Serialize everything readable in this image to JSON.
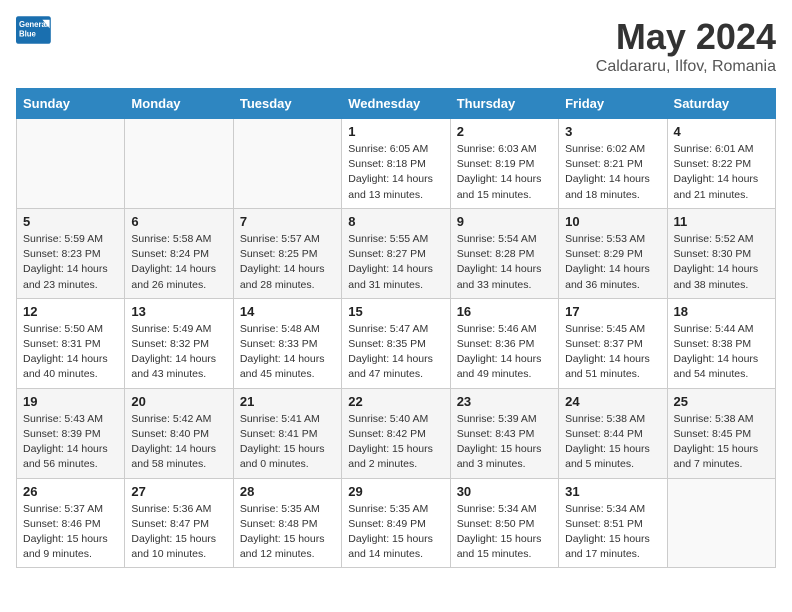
{
  "header": {
    "logo_general": "General",
    "logo_blue": "Blue",
    "month_year": "May 2024",
    "location": "Caldararu, Ilfov, Romania"
  },
  "days_of_week": [
    "Sunday",
    "Monday",
    "Tuesday",
    "Wednesday",
    "Thursday",
    "Friday",
    "Saturday"
  ],
  "weeks": [
    [
      {
        "day": "",
        "sunrise": "",
        "sunset": "",
        "daylight": ""
      },
      {
        "day": "",
        "sunrise": "",
        "sunset": "",
        "daylight": ""
      },
      {
        "day": "",
        "sunrise": "",
        "sunset": "",
        "daylight": ""
      },
      {
        "day": "1",
        "sunrise": "Sunrise: 6:05 AM",
        "sunset": "Sunset: 8:18 PM",
        "daylight": "Daylight: 14 hours and 13 minutes."
      },
      {
        "day": "2",
        "sunrise": "Sunrise: 6:03 AM",
        "sunset": "Sunset: 8:19 PM",
        "daylight": "Daylight: 14 hours and 15 minutes."
      },
      {
        "day": "3",
        "sunrise": "Sunrise: 6:02 AM",
        "sunset": "Sunset: 8:21 PM",
        "daylight": "Daylight: 14 hours and 18 minutes."
      },
      {
        "day": "4",
        "sunrise": "Sunrise: 6:01 AM",
        "sunset": "Sunset: 8:22 PM",
        "daylight": "Daylight: 14 hours and 21 minutes."
      }
    ],
    [
      {
        "day": "5",
        "sunrise": "Sunrise: 5:59 AM",
        "sunset": "Sunset: 8:23 PM",
        "daylight": "Daylight: 14 hours and 23 minutes."
      },
      {
        "day": "6",
        "sunrise": "Sunrise: 5:58 AM",
        "sunset": "Sunset: 8:24 PM",
        "daylight": "Daylight: 14 hours and 26 minutes."
      },
      {
        "day": "7",
        "sunrise": "Sunrise: 5:57 AM",
        "sunset": "Sunset: 8:25 PM",
        "daylight": "Daylight: 14 hours and 28 minutes."
      },
      {
        "day": "8",
        "sunrise": "Sunrise: 5:55 AM",
        "sunset": "Sunset: 8:27 PM",
        "daylight": "Daylight: 14 hours and 31 minutes."
      },
      {
        "day": "9",
        "sunrise": "Sunrise: 5:54 AM",
        "sunset": "Sunset: 8:28 PM",
        "daylight": "Daylight: 14 hours and 33 minutes."
      },
      {
        "day": "10",
        "sunrise": "Sunrise: 5:53 AM",
        "sunset": "Sunset: 8:29 PM",
        "daylight": "Daylight: 14 hours and 36 minutes."
      },
      {
        "day": "11",
        "sunrise": "Sunrise: 5:52 AM",
        "sunset": "Sunset: 8:30 PM",
        "daylight": "Daylight: 14 hours and 38 minutes."
      }
    ],
    [
      {
        "day": "12",
        "sunrise": "Sunrise: 5:50 AM",
        "sunset": "Sunset: 8:31 PM",
        "daylight": "Daylight: 14 hours and 40 minutes."
      },
      {
        "day": "13",
        "sunrise": "Sunrise: 5:49 AM",
        "sunset": "Sunset: 8:32 PM",
        "daylight": "Daylight: 14 hours and 43 minutes."
      },
      {
        "day": "14",
        "sunrise": "Sunrise: 5:48 AM",
        "sunset": "Sunset: 8:33 PM",
        "daylight": "Daylight: 14 hours and 45 minutes."
      },
      {
        "day": "15",
        "sunrise": "Sunrise: 5:47 AM",
        "sunset": "Sunset: 8:35 PM",
        "daylight": "Daylight: 14 hours and 47 minutes."
      },
      {
        "day": "16",
        "sunrise": "Sunrise: 5:46 AM",
        "sunset": "Sunset: 8:36 PM",
        "daylight": "Daylight: 14 hours and 49 minutes."
      },
      {
        "day": "17",
        "sunrise": "Sunrise: 5:45 AM",
        "sunset": "Sunset: 8:37 PM",
        "daylight": "Daylight: 14 hours and 51 minutes."
      },
      {
        "day": "18",
        "sunrise": "Sunrise: 5:44 AM",
        "sunset": "Sunset: 8:38 PM",
        "daylight": "Daylight: 14 hours and 54 minutes."
      }
    ],
    [
      {
        "day": "19",
        "sunrise": "Sunrise: 5:43 AM",
        "sunset": "Sunset: 8:39 PM",
        "daylight": "Daylight: 14 hours and 56 minutes."
      },
      {
        "day": "20",
        "sunrise": "Sunrise: 5:42 AM",
        "sunset": "Sunset: 8:40 PM",
        "daylight": "Daylight: 14 hours and 58 minutes."
      },
      {
        "day": "21",
        "sunrise": "Sunrise: 5:41 AM",
        "sunset": "Sunset: 8:41 PM",
        "daylight": "Daylight: 15 hours and 0 minutes."
      },
      {
        "day": "22",
        "sunrise": "Sunrise: 5:40 AM",
        "sunset": "Sunset: 8:42 PM",
        "daylight": "Daylight: 15 hours and 2 minutes."
      },
      {
        "day": "23",
        "sunrise": "Sunrise: 5:39 AM",
        "sunset": "Sunset: 8:43 PM",
        "daylight": "Daylight: 15 hours and 3 minutes."
      },
      {
        "day": "24",
        "sunrise": "Sunrise: 5:38 AM",
        "sunset": "Sunset: 8:44 PM",
        "daylight": "Daylight: 15 hours and 5 minutes."
      },
      {
        "day": "25",
        "sunrise": "Sunrise: 5:38 AM",
        "sunset": "Sunset: 8:45 PM",
        "daylight": "Daylight: 15 hours and 7 minutes."
      }
    ],
    [
      {
        "day": "26",
        "sunrise": "Sunrise: 5:37 AM",
        "sunset": "Sunset: 8:46 PM",
        "daylight": "Daylight: 15 hours and 9 minutes."
      },
      {
        "day": "27",
        "sunrise": "Sunrise: 5:36 AM",
        "sunset": "Sunset: 8:47 PM",
        "daylight": "Daylight: 15 hours and 10 minutes."
      },
      {
        "day": "28",
        "sunrise": "Sunrise: 5:35 AM",
        "sunset": "Sunset: 8:48 PM",
        "daylight": "Daylight: 15 hours and 12 minutes."
      },
      {
        "day": "29",
        "sunrise": "Sunrise: 5:35 AM",
        "sunset": "Sunset: 8:49 PM",
        "daylight": "Daylight: 15 hours and 14 minutes."
      },
      {
        "day": "30",
        "sunrise": "Sunrise: 5:34 AM",
        "sunset": "Sunset: 8:50 PM",
        "daylight": "Daylight: 15 hours and 15 minutes."
      },
      {
        "day": "31",
        "sunrise": "Sunrise: 5:34 AM",
        "sunset": "Sunset: 8:51 PM",
        "daylight": "Daylight: 15 hours and 17 minutes."
      },
      {
        "day": "",
        "sunrise": "",
        "sunset": "",
        "daylight": ""
      }
    ]
  ]
}
